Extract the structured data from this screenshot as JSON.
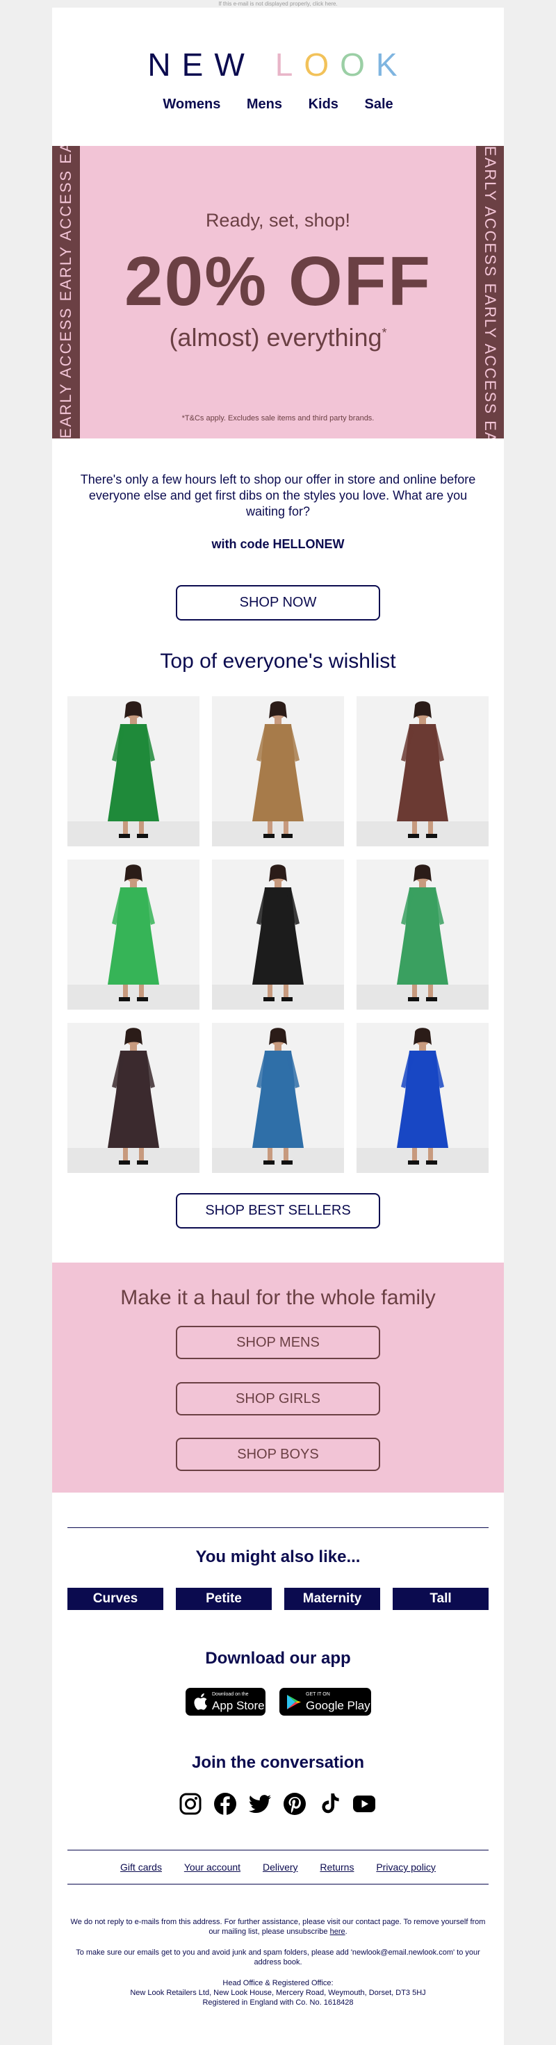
{
  "preheader": "If this e-mail is not displayed properly, click here.",
  "brand": {
    "logo": "NEW LOOK",
    "letters": [
      "N",
      "E",
      "W",
      "L",
      "O",
      "O",
      "K"
    ],
    "letter_colors": [
      "#0b0b4f",
      "#0b0b4f",
      "#0b0b4f",
      "#e8b5c8",
      "#f2c25a",
      "#9bcfa5",
      "#7fb5e0"
    ]
  },
  "nav": [
    "Womens",
    "Mens",
    "Kids",
    "Sale"
  ],
  "hero": {
    "strip_text": "EARLY ACCESS  EARLY ACCESS  EARLY ACCESS",
    "line1": "Ready, set, shop!",
    "line2": "20% OFF",
    "line3": "(almost) everything",
    "asterisk": "*",
    "terms": "*T&Cs apply. Excludes sale items and third party brands.",
    "colors": {
      "background": "#f2c4d6",
      "accent": "#6b4044"
    }
  },
  "intro": "There's only a few hours left to shop our offer in store and online before everyone else and get first dibs on the styles you love. What are you waiting for?",
  "code_line": "with code HELLONEW",
  "shop_now": "SHOP NOW",
  "wishlist": {
    "title": "Top of everyone's wishlist",
    "products": [
      {
        "icon": "green-gingham-dress-image",
        "color": "#1f8a3a"
      },
      {
        "icon": "leopard-skirt-image",
        "color": "#a77b4a"
      },
      {
        "icon": "brown-print-dress-image",
        "color": "#6b3a33"
      },
      {
        "icon": "green-skirt-image",
        "color": "#36b457"
      },
      {
        "icon": "black-tote-bag-image",
        "color": "#1c1c1c"
      },
      {
        "icon": "green-spot-dress-image",
        "color": "#3aa060"
      },
      {
        "icon": "pink-leopard-dress-image",
        "color": "#3b2a2e"
      },
      {
        "icon": "blue-print-dress-image",
        "color": "#2f6fa8"
      },
      {
        "icon": "cobalt-dress-image",
        "color": "#1847c4"
      }
    ],
    "button": "SHOP BEST SELLERS"
  },
  "family": {
    "title": "Make it a haul for the whole family",
    "buttons": [
      "SHOP MENS",
      "SHOP GIRLS",
      "SHOP BOYS"
    ]
  },
  "also_like": {
    "title": "You might also like...",
    "categories": [
      "Curves",
      "Petite",
      "Maternity",
      "Tall"
    ]
  },
  "app": {
    "title": "Download our app",
    "app_store": {
      "small": "Download on the",
      "big": "App Store"
    },
    "google_play": {
      "small": "GET IT ON",
      "big": "Google Play"
    }
  },
  "social": {
    "title": "Join the conversation",
    "icons": [
      "instagram-icon",
      "facebook-icon",
      "twitter-icon",
      "pinterest-icon",
      "tiktok-icon",
      "youtube-icon"
    ]
  },
  "footer_links": [
    "Gift cards",
    "Your account",
    "Delivery",
    "Returns",
    "Privacy policy"
  ],
  "legal": {
    "p1": "We do not reply to e-mails from this address. For further assistance, please visit our contact page. To remove yourself from our mailing list, please unsubscribe",
    "p1_link": "here",
    "p1_end": ".",
    "p2": "To make sure our emails get to you and avoid junk and spam folders, please add 'newlook@email.newlook.com' to your address book.",
    "p3": "Head Office & Registered Office:",
    "p4": "New Look Retailers Ltd, New Look House, Mercery Road, Weymouth, Dorset,  DT3 5HJ",
    "p5": "Registered in England with Co. No. 1618428"
  }
}
